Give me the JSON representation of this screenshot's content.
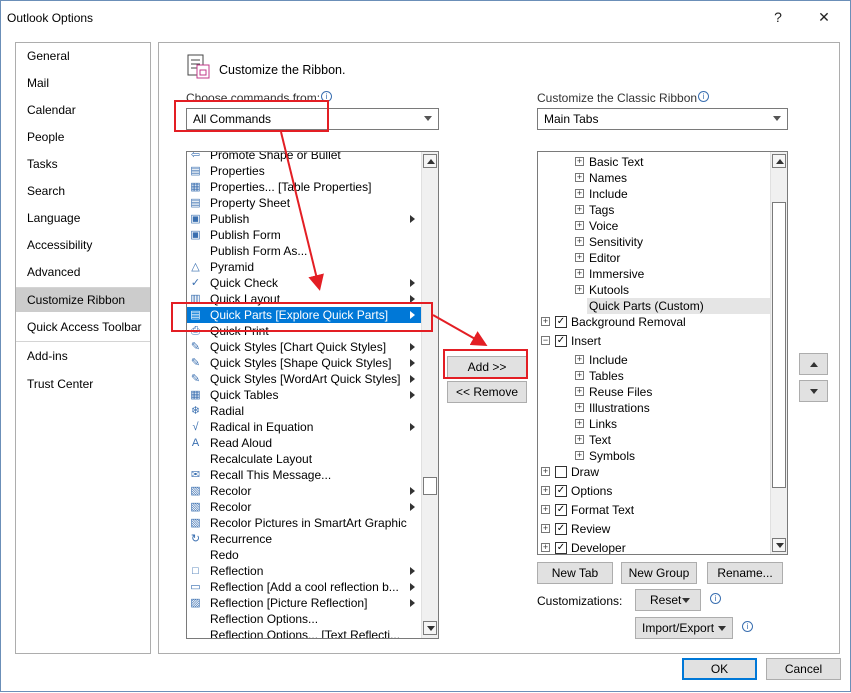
{
  "window": {
    "title": "Outlook Options",
    "help_glyph": "?",
    "close_glyph": "✕"
  },
  "nav": {
    "items": [
      "General",
      "Mail",
      "Calendar",
      "People",
      "Tasks",
      "Search",
      "Language",
      "Accessibility",
      "Advanced",
      "Customize Ribbon",
      "Quick Access Toolbar",
      "Add-ins",
      "Trust Center"
    ],
    "selected": "Customize Ribbon"
  },
  "header": {
    "title": "Customize the Ribbon."
  },
  "left": {
    "label": "Choose commands from:",
    "combo_value": "All Commands",
    "items": [
      {
        "text": "Promote Shape or Bullet",
        "icon": "promote-icon",
        "glyph": "⇦",
        "sub": false
      },
      {
        "text": "Properties",
        "icon": "properties-icon",
        "glyph": "▤",
        "sub": false
      },
      {
        "text": "Properties... [Table Properties]",
        "icon": "table-properties-icon",
        "glyph": "▦",
        "sub": false
      },
      {
        "text": "Property Sheet",
        "icon": "property-sheet-icon",
        "glyph": "▤",
        "sub": false
      },
      {
        "text": "Publish",
        "icon": "publish-icon",
        "glyph": "▣",
        "sub": true
      },
      {
        "text": "Publish Form",
        "icon": "publish-form-icon",
        "glyph": "▣",
        "sub": false
      },
      {
        "text": "Publish Form As...",
        "icon": "",
        "glyph": "",
        "sub": false
      },
      {
        "text": "Pyramid",
        "icon": "pyramid-icon",
        "glyph": "△",
        "sub": false
      },
      {
        "text": "Quick Check",
        "icon": "quick-check-icon",
        "glyph": "✓",
        "sub": true
      },
      {
        "text": "Quick Layout",
        "icon": "quick-layout-icon",
        "glyph": "▥",
        "sub": true
      },
      {
        "text": "Quick Parts [Explore Quick Parts]",
        "icon": "quick-parts-icon",
        "glyph": "▤",
        "sub": true
      },
      {
        "text": "Quick Print",
        "icon": "quick-print-icon",
        "glyph": "⎙",
        "sub": false
      },
      {
        "text": "Quick Styles [Chart Quick Styles]",
        "icon": "brush-icon",
        "glyph": "✎",
        "sub": true
      },
      {
        "text": "Quick Styles [Shape Quick Styles]",
        "icon": "brush-icon",
        "glyph": "✎",
        "sub": true
      },
      {
        "text": "Quick Styles [WordArt Quick Styles]",
        "icon": "brush-icon",
        "glyph": "✎",
        "sub": true
      },
      {
        "text": "Quick Tables",
        "icon": "quick-tables-icon",
        "glyph": "▦",
        "sub": true
      },
      {
        "text": "Radial",
        "icon": "radial-icon",
        "glyph": "❄",
        "sub": false
      },
      {
        "text": "Radical in Equation",
        "icon": "radical-icon",
        "glyph": "√",
        "sub": true
      },
      {
        "text": "Read Aloud",
        "icon": "read-aloud-icon",
        "glyph": "A",
        "sub": false
      },
      {
        "text": "Recalculate Layout",
        "icon": "",
        "glyph": "",
        "sub": false
      },
      {
        "text": "Recall This Message...",
        "icon": "recall-icon",
        "glyph": "✉",
        "sub": false
      },
      {
        "text": "Recolor",
        "icon": "recolor-icon",
        "glyph": "▧",
        "sub": true
      },
      {
        "text": "Recolor",
        "icon": "recolor-icon",
        "glyph": "▧",
        "sub": true
      },
      {
        "text": "Recolor Pictures in SmartArt Graphic",
        "icon": "recolor-smartart-icon",
        "glyph": "▧",
        "sub": false
      },
      {
        "text": "Recurrence",
        "icon": "recurrence-icon",
        "glyph": "↻",
        "sub": false
      },
      {
        "text": "Redo",
        "icon": "",
        "glyph": "",
        "sub": false
      },
      {
        "text": "Reflection",
        "icon": "reflection-icon",
        "glyph": "□",
        "sub": true
      },
      {
        "text": "Reflection [Add a cool reflection b...",
        "icon": "reflection-icon",
        "glyph": "▭",
        "sub": true
      },
      {
        "text": "Reflection [Picture Reflection]",
        "icon": "reflection-icon",
        "glyph": "▨",
        "sub": true
      },
      {
        "text": "Reflection Options...",
        "icon": "",
        "glyph": "",
        "sub": false
      },
      {
        "text": "Reflection Options... [Text Reflecti...",
        "icon": "",
        "glyph": "",
        "sub": false
      }
    ],
    "selected_index": 10
  },
  "middle": {
    "add_label": "Add >>",
    "remove_label": "<< Remove"
  },
  "right": {
    "label": "Customize the Classic Ribbon",
    "combo_value": "Main Tabs",
    "tree": [
      {
        "text": "Basic Text",
        "level": 2,
        "exp": "+",
        "check": null
      },
      {
        "text": "Names",
        "level": 2,
        "exp": "+",
        "check": null
      },
      {
        "text": "Include",
        "level": 2,
        "exp": "+",
        "check": null
      },
      {
        "text": "Tags",
        "level": 2,
        "exp": "+",
        "check": null
      },
      {
        "text": "Voice",
        "level": 2,
        "exp": "+",
        "check": null
      },
      {
        "text": "Sensitivity",
        "level": 2,
        "exp": "+",
        "check": null
      },
      {
        "text": "Editor",
        "level": 2,
        "exp": "+",
        "check": null
      },
      {
        "text": "Immersive",
        "level": 2,
        "exp": "+",
        "check": null
      },
      {
        "text": "Kutools",
        "level": 2,
        "exp": "+",
        "check": null
      },
      {
        "text": "Quick Parts (Custom)",
        "level": 3,
        "exp": null,
        "check": null,
        "sel": true
      },
      {
        "text": "Background Removal",
        "level": 1,
        "exp": "+",
        "check": true
      },
      {
        "text": "Insert",
        "level": 1,
        "exp": "−",
        "check": true
      },
      {
        "text": "Include",
        "level": 2,
        "exp": "+",
        "check": null
      },
      {
        "text": "Tables",
        "level": 2,
        "exp": "+",
        "check": null
      },
      {
        "text": "Reuse Files",
        "level": 2,
        "exp": "+",
        "check": null
      },
      {
        "text": "Illustrations",
        "level": 2,
        "exp": "+",
        "check": null
      },
      {
        "text": "Links",
        "level": 2,
        "exp": "+",
        "check": null
      },
      {
        "text": "Text",
        "level": 2,
        "exp": "+",
        "check": null
      },
      {
        "text": "Symbols",
        "level": 2,
        "exp": "+",
        "check": null
      },
      {
        "text": "Draw",
        "level": 1,
        "exp": "+",
        "check": false
      },
      {
        "text": "Options",
        "level": 1,
        "exp": "+",
        "check": true
      },
      {
        "text": "Format Text",
        "level": 1,
        "exp": "+",
        "check": true
      },
      {
        "text": "Review",
        "level": 1,
        "exp": "+",
        "check": true
      },
      {
        "text": "Developer",
        "level": 1,
        "exp": "+",
        "check": true
      }
    ],
    "new_tab": "New Tab",
    "new_group": "New Group",
    "rename": "Rename...",
    "customizations_label": "Customizations:",
    "reset": "Reset",
    "import_export": "Import/Export"
  },
  "footer": {
    "ok": "OK",
    "cancel": "Cancel"
  },
  "colors": {
    "selection": "#0078d7",
    "annotation": "#e31e24"
  }
}
